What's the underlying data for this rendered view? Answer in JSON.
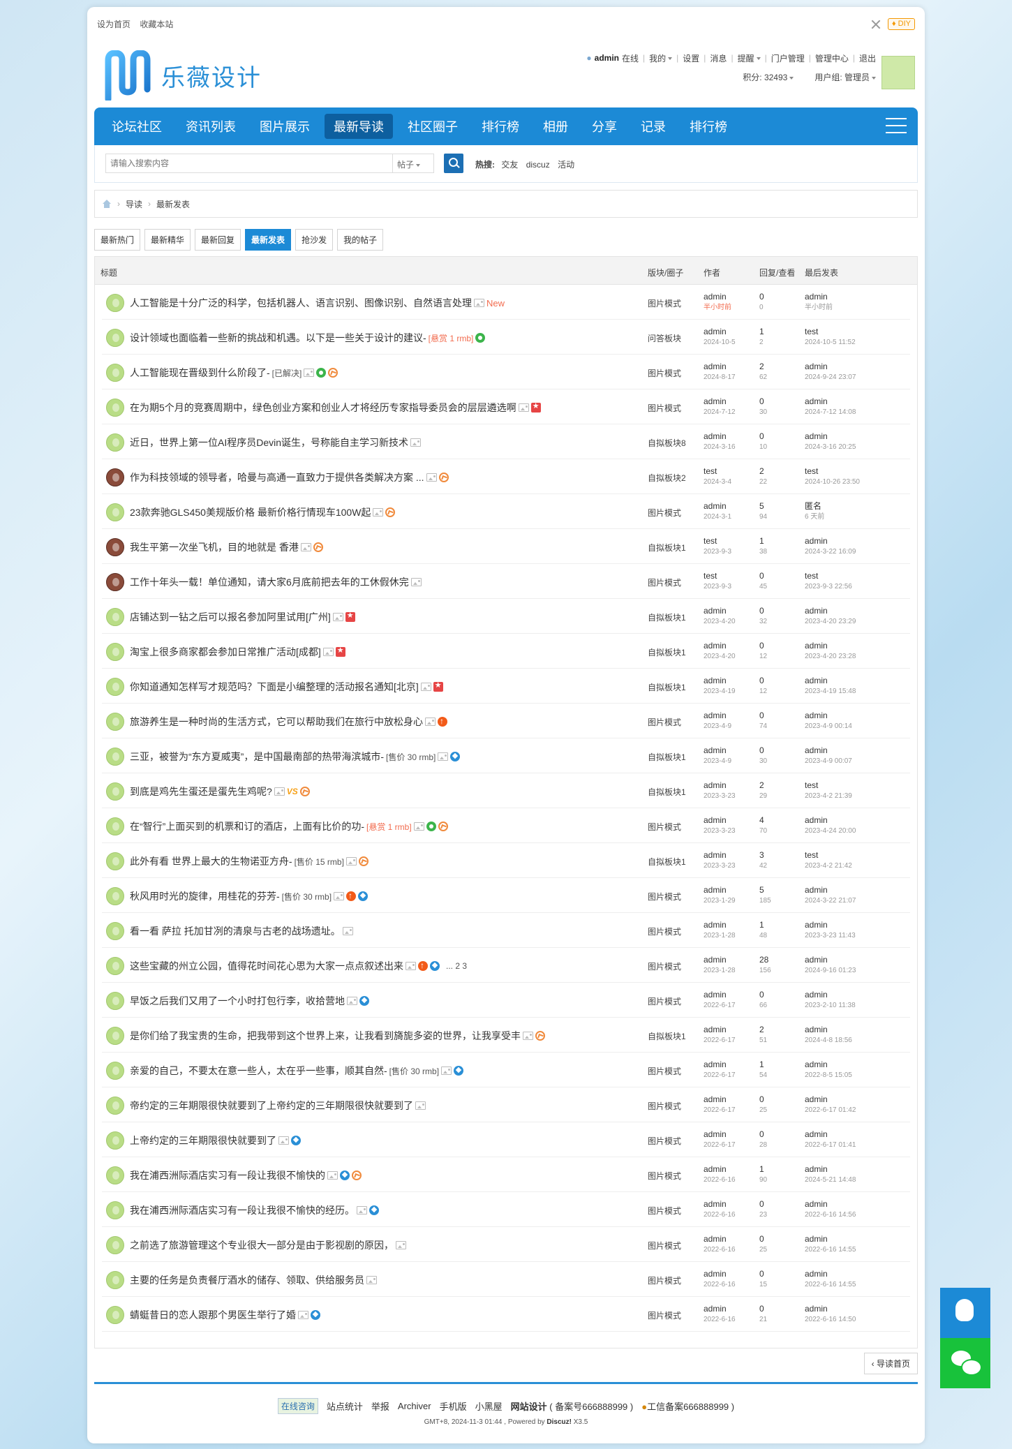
{
  "topbar": {
    "set_home": "设为首页",
    "bookmark": "收藏本站",
    "diy": "DIY"
  },
  "logo": {
    "text": "乐薇设计"
  },
  "user": {
    "name": "admin",
    "online": "在线",
    "mine": "我的",
    "settings": "设置",
    "messages": "消息",
    "remind": "提醒",
    "portal_admin": "门户管理",
    "admin_center": "管理中心",
    "logout": "退出",
    "points": "积分: 32493",
    "group": "用户组: 管理员"
  },
  "nav": {
    "items": [
      "论坛社区",
      "资讯列表",
      "图片展示",
      "最新导读",
      "社区圈子",
      "排行榜",
      "相册",
      "分享",
      "记录",
      "排行榜"
    ],
    "active": 3
  },
  "search": {
    "placeholder": "请输入搜索内容",
    "type": "帖子",
    "hot_label": "热搜:",
    "hot_items": [
      "交友",
      "discuz",
      "活动"
    ]
  },
  "breadcrumb": {
    "level1": "导读",
    "level2": "最新发表"
  },
  "tabs": {
    "items": [
      "最新热门",
      "最新精华",
      "最新回复",
      "最新发表",
      "抢沙发",
      "我的帖子"
    ],
    "active": 3
  },
  "table": {
    "headers": {
      "title": "标题",
      "forum": "版块/圈子",
      "author": "作者",
      "stats": "回复/查看",
      "last": "最后发表"
    },
    "rows": [
      {
        "title": "人工智能是十分广泛的科学，包括机器人、语言识别、图像识别、自然语言处理",
        "icons": [
          "img",
          "new"
        ],
        "forum": "图片模式",
        "author": "admin",
        "date": "半小时前",
        "date_new": true,
        "replies": "0",
        "views": "0",
        "last_user": "admin",
        "last_date": "半小时前",
        "avatar": "frog"
      },
      {
        "title": "设计领域也面临着一些新的挑战和机遇。以下是一些关于设计的建议-",
        "reward": "[悬赏 1 rmb]",
        "icons": [
          "reward"
        ],
        "forum": "问答板块",
        "author": "admin",
        "date": "2024-10-5",
        "replies": "1",
        "views": "2",
        "last_user": "test",
        "last_date": "2024-10-5 11:52",
        "avatar": "frog"
      },
      {
        "title": "人工智能现在晋级到什么阶段了-",
        "price": "[已解决]",
        "icons": [
          "img",
          "reward",
          "hot"
        ],
        "forum": "图片模式",
        "author": "admin",
        "date": "2024-8-17",
        "replies": "2",
        "views": "62",
        "last_user": "admin",
        "last_date": "2024-9-24 23:07",
        "avatar": "frog"
      },
      {
        "title": "在为期5个月的竞赛周期中，绿色创业方案和创业人才将经历专家指导委员会的层层遴选啊",
        "icons": [
          "img",
          "digest"
        ],
        "forum": "图片模式",
        "author": "admin",
        "date": "2024-7-12",
        "replies": "0",
        "views": "30",
        "last_user": "admin",
        "last_date": "2024-7-12 14:08",
        "avatar": "frog"
      },
      {
        "title": "近日，世界上第一位AI程序员Devin诞生，号称能自主学习新技术",
        "icons": [
          "img"
        ],
        "forum": "自拟板块8",
        "author": "admin",
        "date": "2024-3-16",
        "replies": "0",
        "views": "10",
        "last_user": "admin",
        "last_date": "2024-3-16 20:25",
        "avatar": "frog"
      },
      {
        "title": "作为科技领域的领导者，哈曼与高通一直致力于提供各类解决方案 ...",
        "icons": [
          "img",
          "hot"
        ],
        "forum": "自拟板块2",
        "author": "test",
        "date": "2024-3-4",
        "replies": "2",
        "views": "22",
        "last_user": "test",
        "last_date": "2024-10-26 23:50",
        "avatar": "girl"
      },
      {
        "title": "23款奔驰GLS450美规版价格 最新价格行情现车100W起",
        "icons": [
          "img",
          "hot"
        ],
        "forum": "图片模式",
        "author": "admin",
        "date": "2024-3-1",
        "replies": "5",
        "views": "94",
        "last_user": "匿名",
        "last_date": "6 天前",
        "avatar": "frog"
      },
      {
        "title": "我生平第一次坐飞机，目的地就是 香港",
        "icons": [
          "img",
          "hot"
        ],
        "forum": "自拟板块1",
        "author": "test",
        "date": "2023-9-3",
        "replies": "1",
        "views": "38",
        "last_user": "admin",
        "last_date": "2024-3-22 16:09",
        "avatar": "girl"
      },
      {
        "title": "工作十年头一载！单位通知，请大家6月底前把去年的工休假休完",
        "icons": [
          "img"
        ],
        "forum": "图片模式",
        "author": "test",
        "date": "2023-9-3",
        "replies": "0",
        "views": "45",
        "last_user": "test",
        "last_date": "2023-9-3 22:56",
        "avatar": "girl"
      },
      {
        "title": "店铺达到一钻之后可以报名参加阿里试用[广州]",
        "icons": [
          "img",
          "digest"
        ],
        "forum": "自拟板块1",
        "author": "admin",
        "date": "2023-4-20",
        "replies": "0",
        "views": "32",
        "last_user": "admin",
        "last_date": "2023-4-20 23:29",
        "avatar": "frog"
      },
      {
        "title": "淘宝上很多商家都会参加日常推广活动[成都]",
        "icons": [
          "img",
          "digest"
        ],
        "forum": "自拟板块1",
        "author": "admin",
        "date": "2023-4-20",
        "replies": "0",
        "views": "12",
        "last_user": "admin",
        "last_date": "2023-4-20 23:28",
        "avatar": "frog"
      },
      {
        "title": "你知道通知怎样写才规范吗？下面是小编整理的活动报名通知[北京]",
        "icons": [
          "img",
          "digest"
        ],
        "forum": "自拟板块1",
        "author": "admin",
        "date": "2023-4-19",
        "replies": "0",
        "views": "12",
        "last_user": "admin",
        "last_date": "2023-4-19 15:48",
        "avatar": "frog"
      },
      {
        "title": "旅游养生是一种时尚的生活方式，它可以帮助我们在旅行中放松身心",
        "icons": [
          "img",
          "up"
        ],
        "forum": "图片模式",
        "author": "admin",
        "date": "2023-4-9",
        "replies": "0",
        "views": "74",
        "last_user": "admin",
        "last_date": "2023-4-9 00:14",
        "avatar": "frog"
      },
      {
        "title": "三亚，被誉为“东方夏威夷”，是中国最南部的热带海滨城市-",
        "price": "[售价 30 rmb]",
        "icons": [
          "img",
          "diamond"
        ],
        "forum": "自拟板块1",
        "author": "admin",
        "date": "2023-4-9",
        "replies": "0",
        "views": "30",
        "last_user": "admin",
        "last_date": "2023-4-9 00:07",
        "avatar": "frog"
      },
      {
        "title": "到底是鸡先生蛋还是蛋先生鸡呢?",
        "icons": [
          "img",
          "vs",
          "hot"
        ],
        "forum": "自拟板块1",
        "author": "admin",
        "date": "2023-3-23",
        "replies": "2",
        "views": "29",
        "last_user": "test",
        "last_date": "2023-4-2 21:39",
        "avatar": "frog"
      },
      {
        "title": "在“智行”上面买到的机票和订的酒店，上面有比价的功-",
        "reward": "[悬赏 1 rmb]",
        "icons": [
          "img",
          "reward",
          "hot"
        ],
        "forum": "图片模式",
        "author": "admin",
        "date": "2023-3-23",
        "replies": "4",
        "views": "70",
        "last_user": "admin",
        "last_date": "2023-4-24 20:00",
        "avatar": "frog"
      },
      {
        "title": "此外有看 世界上最大的生物诺亚方舟-",
        "price": "[售价 15 rmb]",
        "icons": [
          "img",
          "hot"
        ],
        "forum": "自拟板块1",
        "author": "admin",
        "date": "2023-3-23",
        "replies": "3",
        "views": "42",
        "last_user": "test",
        "last_date": "2023-4-2 21:42",
        "avatar": "frog"
      },
      {
        "title": "秋风用时光的旋律，用桂花的芬芳-",
        "price": "[售价 30 rmb]",
        "icons": [
          "img",
          "up",
          "diamond"
        ],
        "forum": "图片模式",
        "author": "admin",
        "date": "2023-1-29",
        "replies": "5",
        "views": "185",
        "last_user": "admin",
        "last_date": "2024-3-22 21:07",
        "avatar": "frog"
      },
      {
        "title": "看一看 萨拉 托加甘冽的清泉与古老的战场遗址。",
        "icons": [
          "img"
        ],
        "forum": "图片模式",
        "author": "admin",
        "date": "2023-1-28",
        "replies": "1",
        "views": "48",
        "last_user": "admin",
        "last_date": "2023-3-23 11:43",
        "avatar": "frog"
      },
      {
        "title": "这些宝藏的州立公园，值得花时间花心思为大家一点点叙述出来",
        "icons": [
          "img",
          "up",
          "diamond"
        ],
        "pages": "... 2 3",
        "forum": "图片模式",
        "author": "admin",
        "date": "2023-1-28",
        "replies": "28",
        "views": "156",
        "last_user": "admin",
        "last_date": "2024-9-16 01:23",
        "avatar": "frog"
      },
      {
        "title": "早饭之后我们又用了一个小时打包行李，收拾营地",
        "icons": [
          "img",
          "diamond"
        ],
        "forum": "图片模式",
        "author": "admin",
        "date": "2022-6-17",
        "replies": "0",
        "views": "66",
        "last_user": "admin",
        "last_date": "2023-2-10 11:38",
        "avatar": "frog"
      },
      {
        "title": "是你们给了我宝贵的生命，把我带到这个世界上来，让我看到旖旎多姿的世界，让我享受丰",
        "icons": [
          "img",
          "hot"
        ],
        "forum": "自拟板块1",
        "author": "admin",
        "date": "2022-6-17",
        "replies": "2",
        "views": "51",
        "last_user": "admin",
        "last_date": "2024-4-8 18:56",
        "avatar": "frog"
      },
      {
        "title": "亲爱的自己，不要太在意一些人，太在乎一些事，顺其自然-",
        "price": "[售价 30 rmb]",
        "icons": [
          "img",
          "diamond"
        ],
        "forum": "图片模式",
        "author": "admin",
        "date": "2022-6-17",
        "replies": "1",
        "views": "54",
        "last_user": "admin",
        "last_date": "2022-8-5 15:05",
        "avatar": "frog"
      },
      {
        "title": "帝约定的三年期限很快就要到了上帝约定的三年期限很快就要到了",
        "icons": [
          "img"
        ],
        "forum": "图片模式",
        "author": "admin",
        "date": "2022-6-17",
        "replies": "0",
        "views": "25",
        "last_user": "admin",
        "last_date": "2022-6-17 01:42",
        "avatar": "frog"
      },
      {
        "title": "上帝约定的三年期限很快就要到了",
        "icons": [
          "img",
          "diamond"
        ],
        "forum": "图片模式",
        "author": "admin",
        "date": "2022-6-17",
        "replies": "0",
        "views": "28",
        "last_user": "admin",
        "last_date": "2022-6-17 01:41",
        "avatar": "frog"
      },
      {
        "title": "我在浦西洲际酒店实习有一段让我很不愉快的",
        "icons": [
          "img",
          "diamond",
          "hot"
        ],
        "forum": "图片模式",
        "author": "admin",
        "date": "2022-6-16",
        "replies": "1",
        "views": "90",
        "last_user": "admin",
        "last_date": "2024-5-21 14:48",
        "avatar": "frog"
      },
      {
        "title": "我在浦西洲际酒店实习有一段让我很不愉快的经历。",
        "icons": [
          "img",
          "diamond"
        ],
        "forum": "图片模式",
        "author": "admin",
        "date": "2022-6-16",
        "replies": "0",
        "views": "23",
        "last_user": "admin",
        "last_date": "2022-6-16 14:56",
        "avatar": "frog"
      },
      {
        "title": "之前选了旅游管理这个专业很大一部分是由于影视剧的原因，",
        "icons": [
          "img"
        ],
        "forum": "图片模式",
        "author": "admin",
        "date": "2022-6-16",
        "replies": "0",
        "views": "25",
        "last_user": "admin",
        "last_date": "2022-6-16 14:55",
        "avatar": "frog"
      },
      {
        "title": "主要的任务是负责餐厅酒水的储存、领取、供给服务员",
        "icons": [
          "img"
        ],
        "forum": "图片模式",
        "author": "admin",
        "date": "2022-6-16",
        "replies": "0",
        "views": "15",
        "last_user": "admin",
        "last_date": "2022-6-16 14:55",
        "avatar": "frog"
      },
      {
        "title": "蜻蜓昔日的恋人跟那个男医生举行了婚",
        "icons": [
          "img",
          "diamond"
        ],
        "forum": "图片模式",
        "author": "admin",
        "date": "2022-6-16",
        "replies": "0",
        "views": "21",
        "last_user": "admin",
        "last_date": "2022-6-16 14:50",
        "avatar": "frog"
      }
    ]
  },
  "back": {
    "label": "导读首页"
  },
  "footer": {
    "consult": "在线咨询",
    "stats": "站点统计",
    "report": "举报",
    "archiver": "Archiver",
    "mobile": "手机版",
    "dark": "小黑屋",
    "site": "网站设计",
    "icp": "( 备案号666888999 )",
    "icp2": "工信备案666888999 )",
    "copy": "GMT+8, 2024-11-3 01:44 , Powered by",
    "discuz": "Discuz!",
    "version": "X3.5"
  },
  "colors": {
    "primary": "#1c8ad6",
    "nav_active": "#0d5f9f",
    "hot": "#f26c4f",
    "wechat": "#18c23b"
  }
}
